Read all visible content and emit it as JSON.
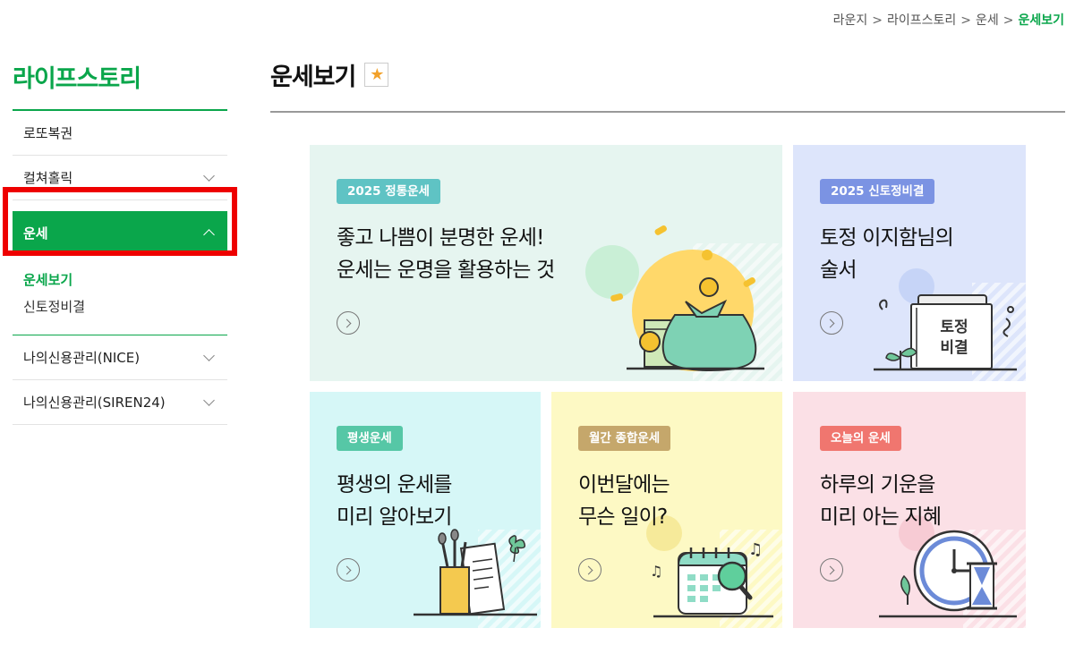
{
  "breadcrumb": {
    "items": [
      "라운지",
      "라이프스토리",
      "운세"
    ],
    "separator": ">",
    "current": "운세보기"
  },
  "sidebar": {
    "title": "라이프스토리",
    "items": [
      {
        "label": "로또복권"
      },
      {
        "label": "컬쳐홀릭"
      },
      {
        "label": "운세"
      },
      {
        "label": "나의신용관리(NICE)"
      },
      {
        "label": "나의신용관리(SIREN24)"
      }
    ],
    "submenu": [
      {
        "label": "운세보기"
      },
      {
        "label": "신토정비결"
      }
    ]
  },
  "page": {
    "title": "운세보기"
  },
  "cards": [
    {
      "badge": "2025 정통운세",
      "line1": "좋고 나쁨이 분명한 운세!",
      "line2": "운세는 운명을 활용하는 것"
    },
    {
      "badge": "2025 신토정비결",
      "line1": "토정 이지함님의",
      "line2": "술서",
      "book_line1": "토정",
      "book_line2": "비결"
    },
    {
      "badge": "평생운세",
      "line1": "평생의 운세를",
      "line2": "미리 알아보기"
    },
    {
      "badge": "월간 종합운세",
      "line1": "이번달에는",
      "line2": "무슨 일이?"
    },
    {
      "badge": "오늘의 운세",
      "line1": "하루의 기운을",
      "line2": "미리 아는 지혜"
    }
  ],
  "colors": {
    "accent": "#0aa64b",
    "highlight": "#ee0000",
    "card1_bg": "#e6f5f0",
    "card1_badge": "#5fc3c4",
    "card2_bg": "#dde5fb",
    "card2_badge": "#7b93e3",
    "card3_bg": "#d6f7f7",
    "card3_badge": "#56c7a6",
    "card4_bg": "#fdf9c4",
    "card4_badge": "#c5a76b",
    "card5_bg": "#fbe0e6",
    "card5_badge": "#f0766f"
  }
}
